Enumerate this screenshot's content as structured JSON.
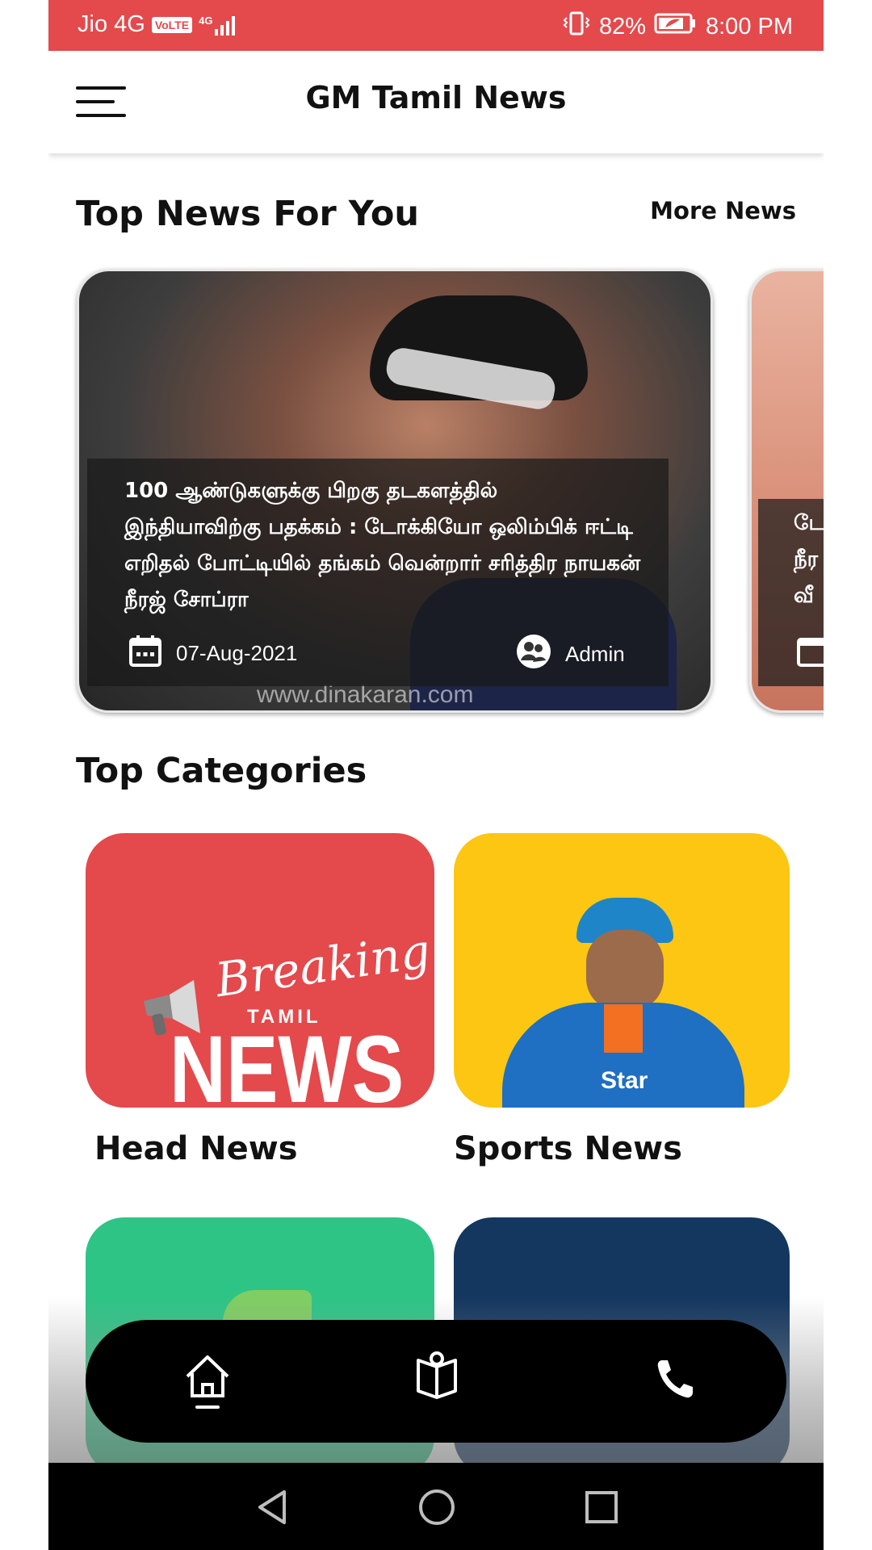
{
  "status_bar": {
    "carrier": "Jio 4G",
    "volte": "VoLTE",
    "network": "4G",
    "battery": "82%",
    "time": "8:00 PM"
  },
  "app_bar": {
    "title": "GM Tamil News",
    "menu_icon": "hamburger-menu-icon"
  },
  "top_news": {
    "title": "Top News For You",
    "more_label": "More News",
    "cards": [
      {
        "headline": "100 ஆண்டுகளுக்கு பிறகு தடகளத்தில் இந்தியாவிற்கு பதக்கம் : டோக்கியோ ஒலிம்பிக் ஈட்டி எறிதல் போட்டியில் தங்கம் வென்றார் சரித்திர நாயகன் நீரஜ் சோப்ரா",
        "date": "07-Aug-2021",
        "author": "Admin",
        "watermark": "www.dinakaran.com"
      },
      {
        "headline": "டே நீர வீ"
      }
    ]
  },
  "categories": {
    "title": "Top Categories",
    "items": [
      {
        "label": "Head News",
        "color": "#e4494c",
        "art": {
          "script": "Breaking",
          "small": "TAMIL",
          "big": "NEWS"
        }
      },
      {
        "label": "Sports News",
        "color": "#fcc613",
        "art": {
          "jersey_text": "Star"
        }
      },
      {
        "label": "",
        "color": "#2ec486"
      },
      {
        "label": "",
        "color": "#14375f"
      }
    ]
  },
  "bottom_nav": {
    "items": [
      {
        "icon": "home-icon",
        "active": true
      },
      {
        "icon": "book-icon",
        "active": false
      },
      {
        "icon": "phone-icon",
        "active": false
      }
    ]
  },
  "system_nav": {
    "items": [
      "back-icon",
      "home-circle-icon",
      "recents-icon"
    ]
  }
}
